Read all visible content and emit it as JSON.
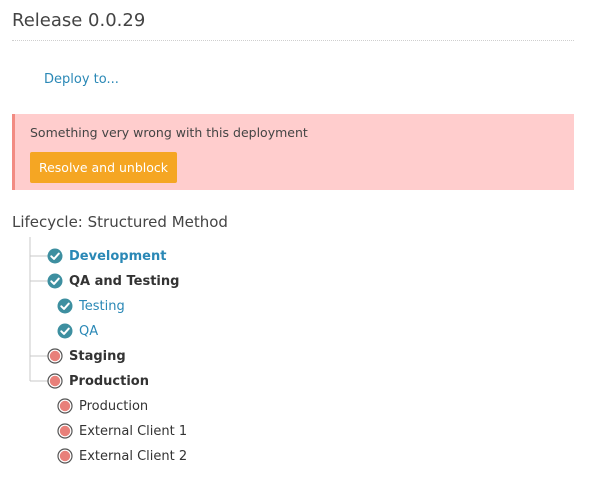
{
  "release": {
    "title": "Release 0.0.29"
  },
  "actions": {
    "deploy_label": "Deploy to..."
  },
  "alert": {
    "message": "Something very wrong with this deployment",
    "button_label": "Resolve and unblock"
  },
  "lifecycle": {
    "title": "Lifecycle: Structured Method",
    "phases": [
      {
        "label": "Development",
        "status": "complete",
        "icon": "check-circle-icon"
      },
      {
        "label": "QA and Testing",
        "status": "complete",
        "icon": "check-circle-icon",
        "environments": [
          {
            "label": "Testing",
            "status": "complete",
            "icon": "check-circle-icon"
          },
          {
            "label": "QA",
            "status": "complete",
            "icon": "check-circle-icon"
          }
        ]
      },
      {
        "label": "Staging",
        "status": "pending",
        "icon": "pending-dot-icon"
      },
      {
        "label": "Production",
        "status": "pending",
        "icon": "pending-dot-icon",
        "environments": [
          {
            "label": "Production",
            "status": "pending",
            "icon": "pending-dot-icon"
          },
          {
            "label": "External Client 1",
            "status": "pending",
            "icon": "pending-dot-icon"
          },
          {
            "label": "External Client 2",
            "status": "pending",
            "icon": "pending-dot-icon"
          }
        ]
      }
    ]
  },
  "colors": {
    "complete": "#3d8fa0",
    "pending_fill": "#e8807a",
    "link": "#2a88b6",
    "alert_bg": "#ffcdcd",
    "button_bg": "#f5a623"
  }
}
